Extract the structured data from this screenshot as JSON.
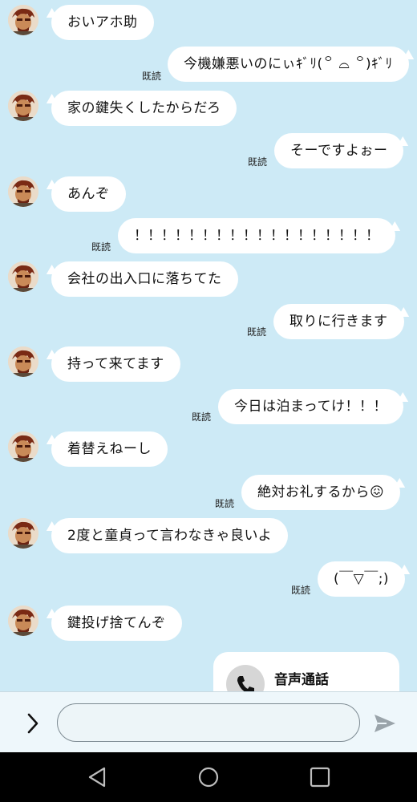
{
  "read_label": "既読",
  "messages": [
    {
      "side": "in",
      "text": "おいアホ助"
    },
    {
      "side": "out",
      "text": "今機嫌悪いのにぃｷﾞﾘ(꒪ ⌓ ꒪)ｷﾞﾘ",
      "read": true
    },
    {
      "side": "in",
      "text": "家の鍵失くしたからだろ"
    },
    {
      "side": "out",
      "text": "そーですよぉー",
      "read": true
    },
    {
      "side": "in",
      "text": "あんぞ"
    },
    {
      "side": "out",
      "text": "！！！！！！！！！！！！！！！！！！",
      "read": true
    },
    {
      "side": "in",
      "text": "会社の出入口に落ちてた"
    },
    {
      "side": "out",
      "text": "取りに行きます",
      "read": true
    },
    {
      "side": "in",
      "text": "持って来てます"
    },
    {
      "side": "out",
      "text": "今日は泊まってけ！！！",
      "read": true
    },
    {
      "side": "in",
      "text": "着替えねーし"
    },
    {
      "side": "out",
      "text": "絶対お礼するから😖",
      "read": true
    },
    {
      "side": "in",
      "text": "2度と童貞って言わなきゃ良いよ"
    },
    {
      "side": "out",
      "text": "(￣▽￣;)",
      "read": true
    },
    {
      "side": "in",
      "text": "鍵投げ捨てんぞ"
    }
  ],
  "call": {
    "title": "音声通話",
    "icon": "phone-icon"
  },
  "composer": {
    "placeholder": "",
    "value": "",
    "expand_icon": "chevron-right-icon",
    "send_icon": "send-icon"
  },
  "navigation": {
    "icons": [
      "back-triangle-icon",
      "home-circle-icon",
      "recents-square-icon"
    ]
  },
  "colors": {
    "background": "#cdeaf6",
    "bubble": "#ffffff",
    "nav": "#000000"
  }
}
